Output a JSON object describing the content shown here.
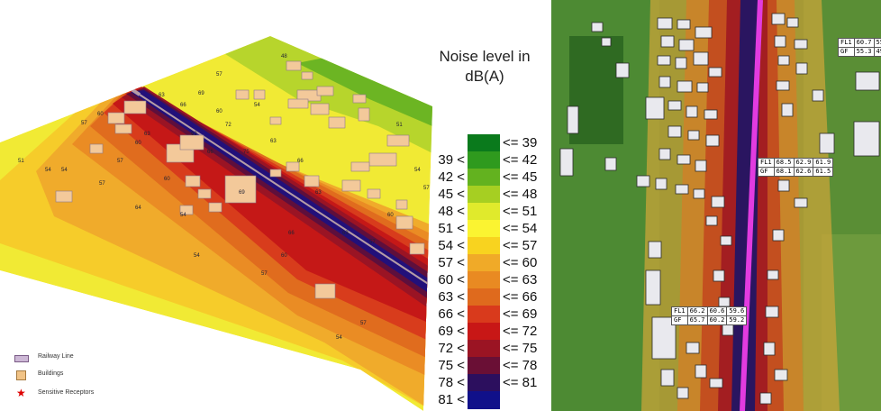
{
  "legend": {
    "title_line1": "Noise level in",
    "title_line2": "dB(A)",
    "bands": [
      {
        "lo": "",
        "hi": "<= 39",
        "color": "#0a7a1c"
      },
      {
        "lo": "39 <",
        "hi": "<= 42",
        "color": "#2f9a1e"
      },
      {
        "lo": "42 <",
        "hi": "<= 45",
        "color": "#63b21f"
      },
      {
        "lo": "45 <",
        "hi": "<= 48",
        "color": "#a6cf22"
      },
      {
        "lo": "48 <",
        "hi": "<= 51",
        "color": "#e0ea2c"
      },
      {
        "lo": "51 <",
        "hi": "<= 54",
        "color": "#fbf431"
      },
      {
        "lo": "54 <",
        "hi": "<= 57",
        "color": "#f8d31f"
      },
      {
        "lo": "57 <",
        "hi": "<= 60",
        "color": "#f0aa28"
      },
      {
        "lo": "60 <",
        "hi": "<= 63",
        "color": "#e98a22"
      },
      {
        "lo": "63 <",
        "hi": "<= 66",
        "color": "#df6a1d"
      },
      {
        "lo": "66 <",
        "hi": "<= 69",
        "color": "#d93a1c"
      },
      {
        "lo": "69 <",
        "hi": "<= 72",
        "color": "#c81716"
      },
      {
        "lo": "72 <",
        "hi": "<= 75",
        "color": "#9b1423"
      },
      {
        "lo": "75 <",
        "hi": "<= 78",
        "color": "#6a0f35"
      },
      {
        "lo": "78 <",
        "hi": "<= 81",
        "color": "#2c0f5e"
      },
      {
        "lo": "81 <",
        "hi": "",
        "color": "#10108a"
      }
    ]
  },
  "map_key": {
    "railway": "Railway Line",
    "buildings": "Buildings",
    "receptors": "Sensitive Receptors"
  },
  "contour_labels": [
    "51",
    "54",
    "57",
    "60",
    "63",
    "66",
    "69",
    "72",
    "75",
    "48",
    "54",
    "57",
    "60",
    "63",
    "66",
    "57",
    "54",
    "51",
    "64",
    "60",
    "63",
    "66",
    "69",
    "54",
    "57",
    "60",
    "63",
    "66",
    "57",
    "54",
    "51",
    "57",
    "60",
    "63",
    "57",
    "54",
    "57",
    "60",
    "63",
    "57",
    "54"
  ],
  "receptors": [
    {
      "rows": [
        [
          "FL1",
          "60.7",
          "55."
        ],
        [
          "GF",
          "55.3",
          "49."
        ]
      ]
    },
    {
      "rows": [
        [
          "FL1",
          "68.5",
          "62.9",
          "61.9"
        ],
        [
          "GF",
          "68.1",
          "62.6",
          "61.5"
        ]
      ]
    },
    {
      "rows": [
        [
          "FL1",
          "66.2",
          "60.6",
          "59.6"
        ],
        [
          "GF",
          "65.7",
          "60.2",
          "59.2"
        ]
      ]
    }
  ]
}
